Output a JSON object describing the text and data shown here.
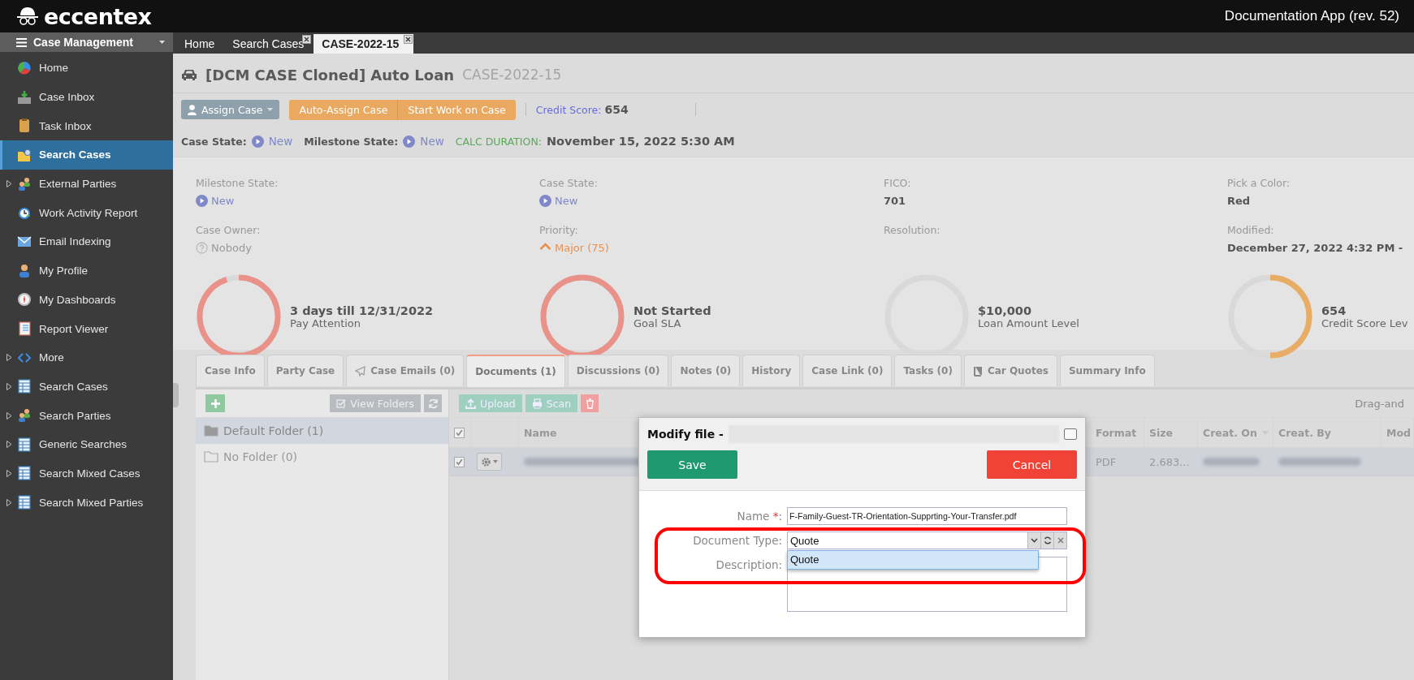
{
  "topbar": {
    "logo": "eccentex",
    "app_title": "Documentation App (rev. 52)"
  },
  "sidebar": {
    "header": "Case Management",
    "items": [
      {
        "label": "Home",
        "kind": "pie",
        "expandable": false,
        "selected": false
      },
      {
        "label": "Case Inbox",
        "kind": "inbox",
        "expandable": false,
        "selected": false
      },
      {
        "label": "Task Inbox",
        "kind": "clipboard",
        "expandable": false,
        "selected": false
      },
      {
        "label": "Search Cases",
        "kind": "folder",
        "expandable": false,
        "selected": true
      },
      {
        "label": "External Parties",
        "kind": "people",
        "expandable": true,
        "selected": false
      },
      {
        "label": "Work Activity Report",
        "kind": "clock",
        "expandable": false,
        "selected": false
      },
      {
        "label": "Email Indexing",
        "kind": "mail",
        "expandable": false,
        "selected": false
      },
      {
        "label": "My Profile",
        "kind": "person",
        "expandable": false,
        "selected": false
      },
      {
        "label": "My Dashboards",
        "kind": "compass",
        "expandable": false,
        "selected": false
      },
      {
        "label": "Report Viewer",
        "kind": "notebook",
        "expandable": false,
        "selected": false
      },
      {
        "label": "More",
        "kind": "code",
        "expandable": true,
        "selected": false
      },
      {
        "label": "Search Cases",
        "kind": "table",
        "expandable": true,
        "selected": false
      },
      {
        "label": "Search Parties",
        "kind": "people",
        "expandable": true,
        "selected": false
      },
      {
        "label": "Generic Searches",
        "kind": "table",
        "expandable": true,
        "selected": false
      },
      {
        "label": "Search Mixed Cases",
        "kind": "table",
        "expandable": true,
        "selected": false
      },
      {
        "label": "Search Mixed Parties",
        "kind": "table",
        "expandable": true,
        "selected": false
      }
    ]
  },
  "tabs": [
    {
      "label": "Home",
      "closable": false,
      "selected": false
    },
    {
      "label": "Search Cases",
      "closable": true,
      "selected": false
    },
    {
      "label": "CASE-2022-15",
      "closable": true,
      "selected": true
    }
  ],
  "case_header": {
    "title": "[DCM CASE Cloned] Auto Loan",
    "case_id": "CASE-2022-15",
    "assign_button": "Assign Case",
    "action_buttons": [
      "Auto-Assign Case",
      "Start Work on Case"
    ],
    "credit_label": "Credit Score:",
    "credit_value": "654",
    "states": [
      {
        "label": "Case State:",
        "value": "New"
      },
      {
        "label": "Milestone State:",
        "value": "New"
      }
    ],
    "duration_label": "CALC DURATION:",
    "duration_value": "November 15, 2022 5:30 AM"
  },
  "summary": {
    "columns": [
      {
        "fields": [
          {
            "label": "Milestone State:",
            "value": "New",
            "kind": "state"
          },
          {
            "label": "Case Owner:",
            "value": "Nobody",
            "kind": "unassigned"
          }
        ],
        "gauge": {
          "title": "3 days till 12/31/2022",
          "caption": "Pay Attention",
          "level": 0.95,
          "color": "#e8928a"
        }
      },
      {
        "fields": [
          {
            "label": "Case State:",
            "value": "New",
            "kind": "state"
          },
          {
            "label": "Priority:",
            "value": "Major (75)",
            "kind": "priority"
          }
        ],
        "gauge": {
          "title": "Not Started",
          "caption": "Goal SLA",
          "level": 1,
          "color": "#e8928a"
        }
      },
      {
        "fields": [
          {
            "label": "FICO:",
            "value": "701",
            "kind": "plain"
          },
          {
            "label": "Resolution:",
            "kind": "empty"
          }
        ],
        "gauge": {
          "title": "$10,000",
          "caption": "Loan Amount Level"
        }
      },
      {
        "fields": [
          {
            "label": "Pick a Color:",
            "value": "Red",
            "kind": "plain"
          },
          {
            "label": "Modified:",
            "value": "December 27, 2022 4:32 PM -",
            "kind": "plain"
          }
        ],
        "gauge": {
          "title": "654",
          "caption": "Credit Score Lev",
          "level": 0.5,
          "color": "#e8ad65"
        }
      }
    ]
  },
  "detail_tabs": [
    {
      "label": "Case Info",
      "kind": "text",
      "selected": false
    },
    {
      "label": "Party Case",
      "kind": "text",
      "selected": false
    },
    {
      "label": "Case Emails (0)",
      "kind": "send",
      "selected": false
    },
    {
      "label": "Documents (1)",
      "kind": "text",
      "selected": true
    },
    {
      "label": "Discussions (0)",
      "kind": "text",
      "selected": false
    },
    {
      "label": "Notes (0)",
      "kind": "text",
      "selected": false
    },
    {
      "label": "History",
      "kind": "text",
      "selected": false
    },
    {
      "label": "Case Link (0)",
      "kind": "text",
      "selected": false
    },
    {
      "label": "Tasks (0)",
      "kind": "text",
      "selected": false
    },
    {
      "label": "Car Quotes",
      "kind": "book",
      "selected": false
    },
    {
      "label": "Summary Info",
      "kind": "text",
      "selected": false
    }
  ],
  "documents": {
    "view_folders": "View Folders",
    "folders": [
      {
        "label": "Default Folder (1)",
        "selected": true
      },
      {
        "label": "No Folder (0)",
        "selected": false
      }
    ],
    "upload": "Upload",
    "scan": "Scan",
    "hint": "Drag-and",
    "table": {
      "header_checked": true,
      "columns": [
        {
          "label": "Name",
          "sorted": false
        },
        {
          "label": "Format",
          "sorted": false
        },
        {
          "label": "Size",
          "sorted": false
        },
        {
          "label": "Creat. On",
          "sorted": true
        },
        {
          "label": "Creat. By",
          "sorted": false
        },
        {
          "label": "Mod",
          "sorted": false
        }
      ],
      "rows": [
        {
          "checked": true,
          "format": "PDF",
          "size": "2.683..."
        }
      ]
    }
  },
  "dialog": {
    "title": "Modify file -",
    "save": "Save",
    "cancel": "Cancel",
    "fields": [
      {
        "label": "Name",
        "required_mark": "*",
        "suffix": ":",
        "kind": "text",
        "value": "F-Family-Guest-TR-Orientation-Supprting-Your-Transfer.pdf"
      },
      {
        "label": "Document Type:",
        "kind": "select",
        "value": "Quote"
      },
      {
        "label": "Description:",
        "kind": "textarea"
      }
    ],
    "options": [
      {
        "label": "Quote",
        "selected": true
      }
    ]
  }
}
